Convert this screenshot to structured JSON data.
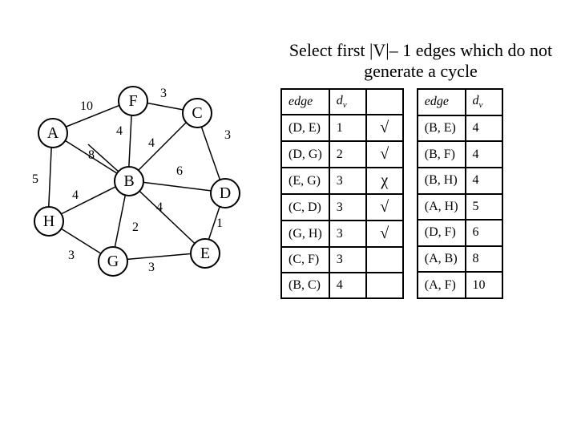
{
  "title": "Select first |V|– 1 edges which do not generate a cycle",
  "nodes": {
    "A": "A",
    "B": "B",
    "C": "C",
    "D": "D",
    "E": "E",
    "F": "F",
    "G": "G",
    "H": "H"
  },
  "weights": {
    "AF": "10",
    "FC": "3",
    "AB_up": "4",
    "CD_r": "3",
    "AB_l": "8",
    "BC": "4",
    "BD": "6",
    "AH": "5",
    "HB": "4",
    "BD2": "4",
    "DE": "1",
    "HG": "3",
    "GB": "2",
    "GE": "3"
  },
  "table1": {
    "headers": [
      "edge",
      "d_v",
      ""
    ],
    "rows": [
      [
        "(D, E)",
        "1",
        "√"
      ],
      [
        "(D, G)",
        "2",
        "√"
      ],
      [
        "(E, G)",
        "3",
        "χ"
      ],
      [
        "(C, D)",
        "3",
        "√"
      ],
      [
        "(G, H)",
        "3",
        "√"
      ],
      [
        "(C, F)",
        "3",
        ""
      ],
      [
        "(B, C)",
        "4",
        ""
      ]
    ]
  },
  "table2": {
    "headers": [
      "edge",
      "d_v"
    ],
    "rows": [
      [
        "(B, E)",
        "4"
      ],
      [
        "(B, F)",
        "4"
      ],
      [
        "(B, H)",
        "4"
      ],
      [
        "(A, H)",
        "5"
      ],
      [
        "(D, F)",
        "6"
      ],
      [
        "(A, B)",
        "8"
      ],
      [
        "(A, F)",
        "10"
      ]
    ]
  }
}
